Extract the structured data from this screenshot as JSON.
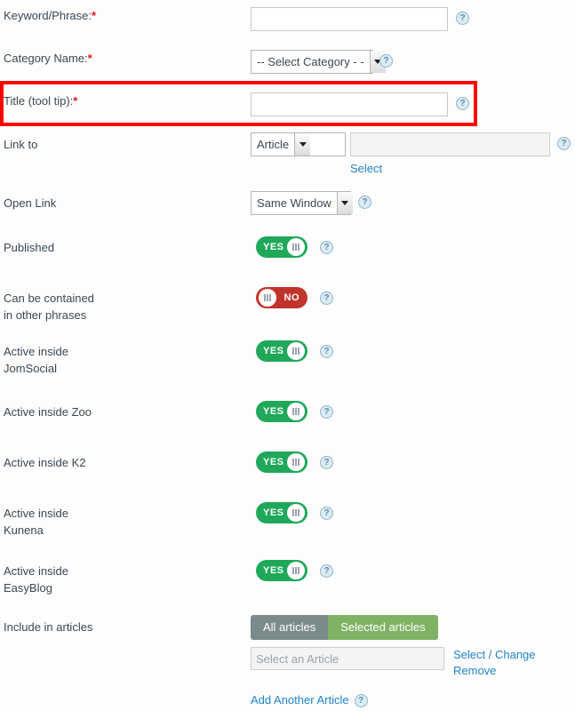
{
  "colors": {
    "link": "#1f84c8",
    "required_asterisk": "#e8121a",
    "toggle_on": "#1fa85a",
    "toggle_off": "#c0352b",
    "button_all_articles": "#7b8a8b",
    "button_selected_articles": "#80b265",
    "highlight_border": "#ff0000",
    "page_background": "#fdfdfd"
  },
  "help_icon": {
    "glyph": "?",
    "name": "help-icon"
  },
  "highlight": {
    "label": "highlighted-field-title-tooltip"
  },
  "rows": {
    "keyword": {
      "label": "Keyword/Phrase:",
      "required": "*",
      "input_value": "",
      "input_placeholder": ""
    },
    "category": {
      "label": "Category Name:",
      "required": "*",
      "selected": "-- Select Category - -"
    },
    "title": {
      "label": "Title (tool tip):",
      "required": "*",
      "input_value": "",
      "input_placeholder": ""
    },
    "link_to": {
      "label": "Link to",
      "selected": "Article",
      "target_value": "",
      "target_placeholder": "",
      "select_link": "Select"
    },
    "open_link": {
      "label": "Open Link",
      "selected": "Same Window"
    },
    "published": {
      "label": "Published",
      "toggle_state": "YES"
    },
    "contained": {
      "label_line1": "Can be contained",
      "label_line2": "in other phrases",
      "toggle_state": "NO"
    },
    "jomsocial": {
      "label_line1": "Active inside",
      "label_line2": "JomSocial",
      "toggle_state": "YES"
    },
    "zoo": {
      "label_line1": "Active inside Zoo",
      "label_line2": "",
      "toggle_state": "YES"
    },
    "k2": {
      "label_line1": "Active inside K2",
      "label_line2": "",
      "toggle_state": "YES"
    },
    "kunena": {
      "label_line1": "Active inside",
      "label_line2": "Kunena",
      "toggle_state": "YES"
    },
    "easyblog": {
      "label_line1": "Active inside",
      "label_line2": "EasyBlog",
      "toggle_state": "YES"
    },
    "include_in_articles": {
      "label": "Include in articles",
      "button_all": "All articles",
      "button_selected": "Selected articles",
      "article_input_value": "",
      "article_input_placeholder": "Select an Article",
      "link_select_change": "Select / Change",
      "link_remove": "Remove",
      "link_add_another": "Add Another Article"
    }
  }
}
